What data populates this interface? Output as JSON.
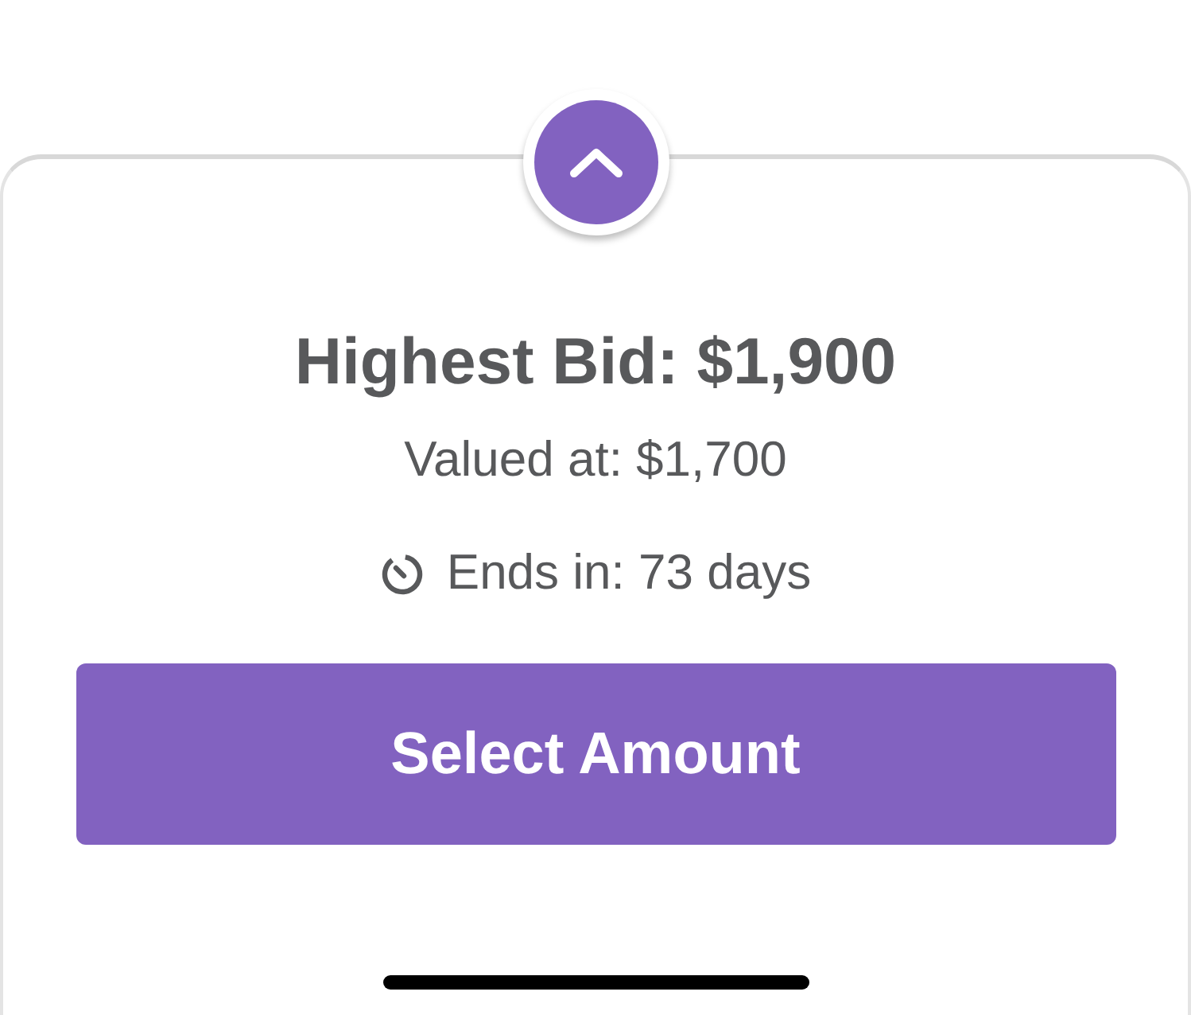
{
  "auction": {
    "highest_bid": "Highest Bid: $1,900",
    "valued_at": "Valued at: $1,700",
    "ends_in": "Ends in: 73 days"
  },
  "button": {
    "label": "Select Amount"
  }
}
